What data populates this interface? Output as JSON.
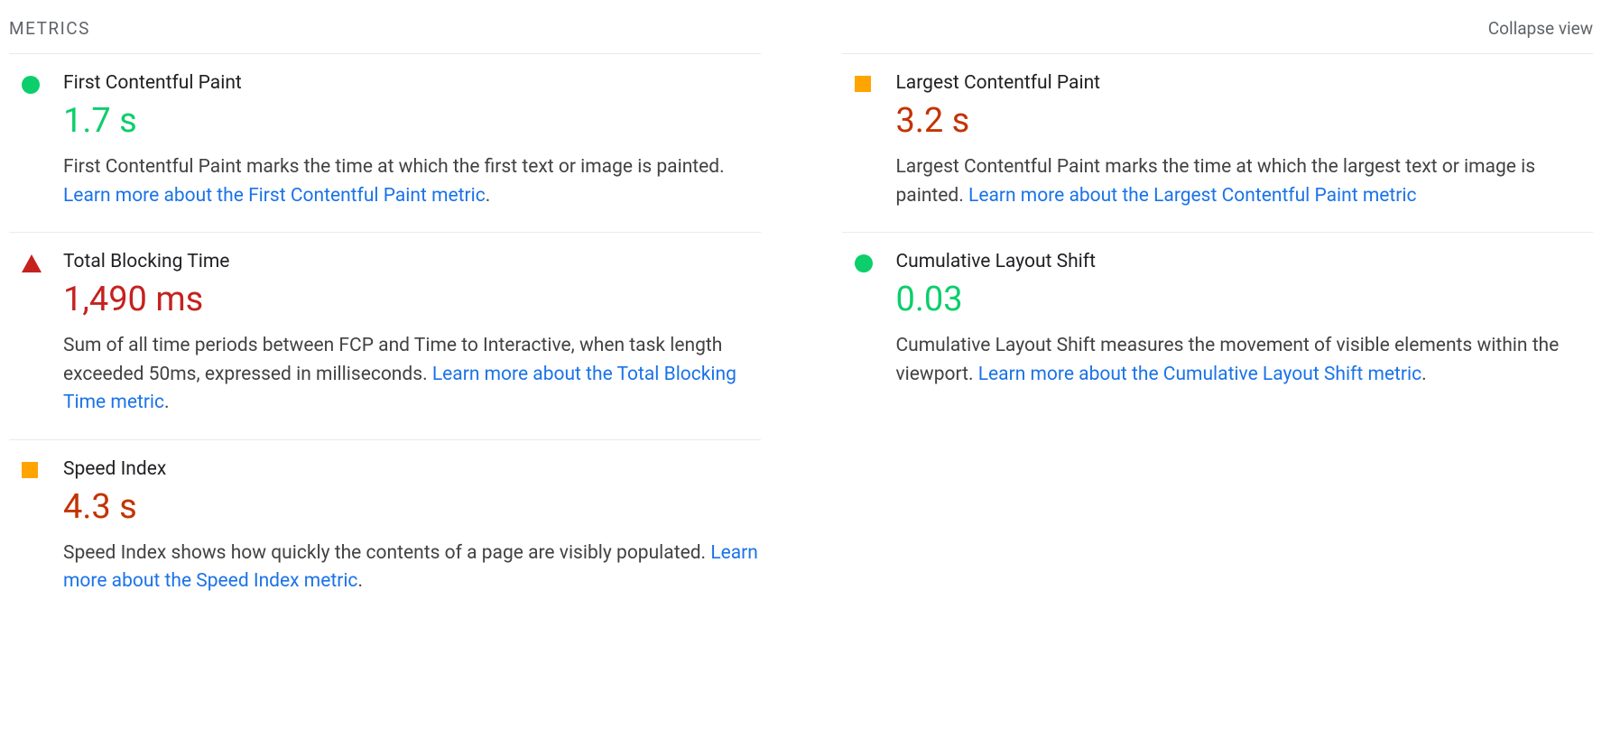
{
  "header": {
    "title": "METRICS",
    "collapse_label": "Collapse view"
  },
  "colors": {
    "good": "#0cce6b",
    "average_icon": "#ffa400",
    "average_value": "#c33300",
    "poor": "#c5221f",
    "link": "#1a73e8"
  },
  "metrics": [
    {
      "id": "fcp",
      "column": "left",
      "status": "good",
      "icon": "circle",
      "title": "First Contentful Paint",
      "value": "1.7 s",
      "description": "First Contentful Paint marks the time at which the first text or image is painted. ",
      "link_text": "Learn more about the First Contentful Paint metric",
      "trailing": "."
    },
    {
      "id": "lcp",
      "column": "right",
      "status": "average",
      "icon": "square",
      "title": "Largest Contentful Paint",
      "value": "3.2 s",
      "description": "Largest Contentful Paint marks the time at which the largest text or image is painted. ",
      "link_text": "Learn more about the Largest Contentful Paint metric",
      "trailing": ""
    },
    {
      "id": "tbt",
      "column": "left",
      "status": "poor",
      "icon": "triangle",
      "title": "Total Blocking Time",
      "value": "1,490 ms",
      "description": "Sum of all time periods between FCP and Time to Interactive, when task length exceeded 50ms, expressed in milliseconds. ",
      "link_text": "Learn more about the Total Blocking Time metric",
      "trailing": "."
    },
    {
      "id": "cls",
      "column": "right",
      "status": "good",
      "icon": "circle",
      "title": "Cumulative Layout Shift",
      "value": "0.03",
      "description": "Cumulative Layout Shift measures the movement of visible elements within the viewport. ",
      "link_text": "Learn more about the Cumulative Layout Shift metric",
      "trailing": "."
    },
    {
      "id": "si",
      "column": "left",
      "status": "average",
      "icon": "square",
      "title": "Speed Index",
      "value": "4.3 s",
      "description": "Speed Index shows how quickly the contents of a page are visibly populated. ",
      "link_text": "Learn more about the Speed Index metric",
      "trailing": "."
    }
  ]
}
